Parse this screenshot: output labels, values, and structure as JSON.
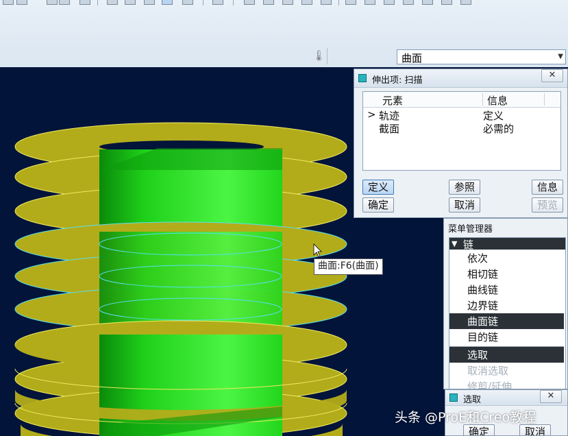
{
  "toolbar": {
    "filter_value": "曲面"
  },
  "sweep_dialog": {
    "title": "伸出项: 扫描",
    "columns": [
      "元素",
      "信息"
    ],
    "rows": [
      {
        "marker": ">",
        "element": "轨迹",
        "info": "定义"
      },
      {
        "marker": "",
        "element": "截面",
        "info": "必需的"
      }
    ],
    "buttons": {
      "define": "定义",
      "ref": "参照",
      "info": "信息",
      "ok": "确定",
      "cancel": "取消",
      "preview": "预览"
    }
  },
  "menu_manager": {
    "title": "菜单管理器",
    "section": "链",
    "items": [
      {
        "label": "依次"
      },
      {
        "label": "相切链"
      },
      {
        "label": "曲线链"
      },
      {
        "label": "边界链"
      },
      {
        "label": "曲面链"
      },
      {
        "label": "目的链"
      }
    ],
    "actions": [
      {
        "label": "选取"
      },
      {
        "label": "取消选取"
      },
      {
        "label": "修剪/延伸"
      }
    ]
  },
  "select_dialog": {
    "title": "选取",
    "ok": "确定",
    "cancel": "取消"
  },
  "tooltip": "曲面:F6(曲面)",
  "watermark": "头条 @ProE和Creo教程",
  "colors": {
    "viewport_bg": "#02143a",
    "thread_fill": "#b3ac1a",
    "cylinder": "#22e81c",
    "highlight": "#56e0f0",
    "selected_bg": "#2b3137"
  }
}
